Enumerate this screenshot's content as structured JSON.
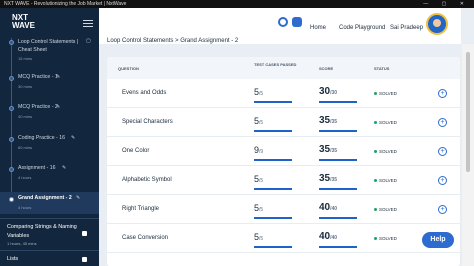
{
  "window": {
    "title": "NXT WAVE - Revolutionizing the Job Market | NxtWave",
    "controls": "— ▢ ✕"
  },
  "sidebar": {
    "logo_line1": "NXT",
    "logo_line2": "WAVE",
    "logo_sub": "",
    "items": [
      {
        "label": "Loop Control Statements | Cheat Sheet",
        "time": "15 mins"
      },
      {
        "label": "MCQ Practice - 1",
        "time": "30 mins"
      },
      {
        "label": "MCQ Practice - 2",
        "time": "40 mins"
      },
      {
        "label": "Coding Practice - 16",
        "time": "60 mins"
      },
      {
        "label": "Assignment - 16",
        "time": "4 hours"
      },
      {
        "label": "Grand Assignment - 2",
        "time": "4 hours"
      }
    ],
    "next_topic": "Comparing Strings & Naming Variables",
    "next_topic_time": "1 hours, 45 mins",
    "lists_label": "Lists"
  },
  "topbar": {
    "home": "Home",
    "playground": "Code Playground",
    "user": "Sai Pradeep"
  },
  "breadcrumb": "Loop Control Statements > Grand Assignment - 2",
  "table": {
    "headers": {
      "question": "QUESTION",
      "testcases": "TEST CASES PASSED",
      "score": "SCORE",
      "status": "STATUS"
    },
    "rows": [
      {
        "question": "Evens and Odds",
        "passed": "5",
        "total": "/5",
        "score": "30",
        "max": "/30",
        "status": "SOLVED"
      },
      {
        "question": "Special Characters",
        "passed": "5",
        "total": "/5",
        "score": "35",
        "max": "/35",
        "status": "SOLVED"
      },
      {
        "question": "One Color",
        "passed": "9",
        "total": "/9",
        "score": "35",
        "max": "/35",
        "status": "SOLVED"
      },
      {
        "question": "Alphabetic Symbol",
        "passed": "5",
        "total": "/5",
        "score": "35",
        "max": "/35",
        "status": "SOLVED"
      },
      {
        "question": "Right Triangle",
        "passed": "5",
        "total": "/5",
        "score": "40",
        "max": "/40",
        "status": "SOLVED"
      },
      {
        "question": "Case Conversion",
        "passed": "5",
        "total": "/5",
        "score": "40",
        "max": "/40",
        "status": "SOLVED"
      }
    ]
  },
  "help_label": "Help",
  "colors": {
    "sidebar": "#12263e",
    "accent": "#1f62c9",
    "solved": "#22a06b"
  }
}
